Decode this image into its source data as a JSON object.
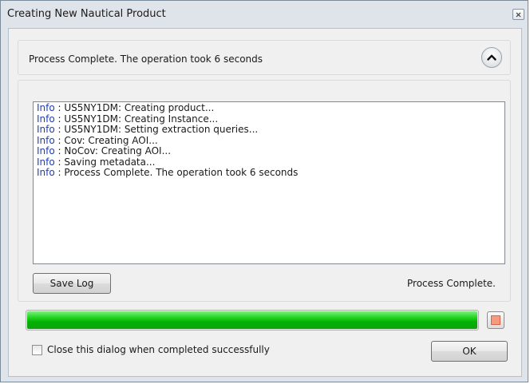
{
  "window": {
    "title": "Creating New Nautical Product"
  },
  "status": {
    "summary": "Process Complete. The operation took 6 seconds"
  },
  "log": {
    "lines": [
      {
        "level": "Info",
        "text": "US5NY1DM: Creating product..."
      },
      {
        "level": "Info",
        "text": "US5NY1DM: Creating Instance..."
      },
      {
        "level": "Info",
        "text": "US5NY1DM: Setting extraction queries..."
      },
      {
        "level": "Info",
        "text": "Cov: Creating AOI..."
      },
      {
        "level": "Info",
        "text": "NoCov: Creating AOI..."
      },
      {
        "level": "Info",
        "text": "Saving metadata..."
      },
      {
        "level": "Info",
        "text": "Process Complete. The operation took 6 seconds"
      }
    ],
    "separator": " : ",
    "save_label": "Save Log",
    "process_status": "Process Complete."
  },
  "progress": {
    "percent": 100,
    "color": "#19c419"
  },
  "footer": {
    "close_checkbox_label": "Close this dialog when completed successfully",
    "close_checkbox_checked": false,
    "ok_label": "OK"
  },
  "icons": {
    "close": "close-icon",
    "collapse": "chevron-up-icon",
    "stop": "stop-icon"
  }
}
